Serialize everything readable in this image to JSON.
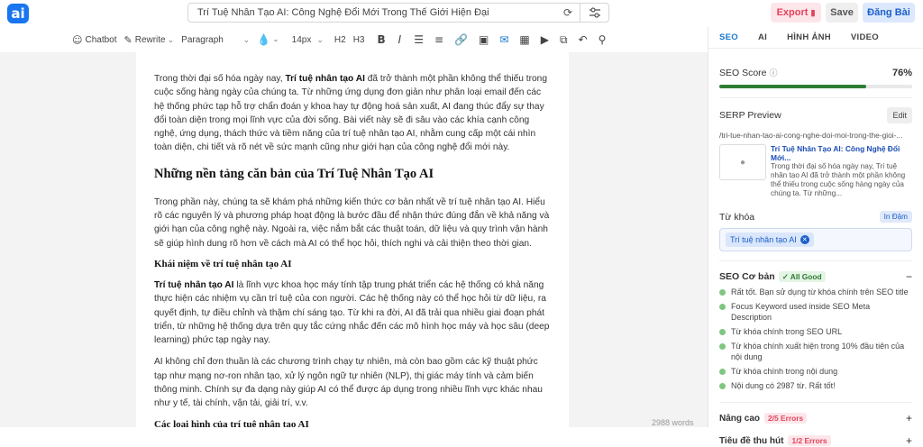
{
  "header": {
    "logo": "ai",
    "doc_title": "Trí Tuệ Nhân Tạo AI: Công Nghệ Đổi Mới Trong Thế Giới Hiện Đại",
    "export_label": "Export",
    "save_label": "Save",
    "publish_label": "Đăng Bài"
  },
  "toolbar": {
    "chatbot_label": "Chatbot",
    "rewrite_label": "Rewrite",
    "paragraph_select": "Paragraph",
    "font_size_select": "14px",
    "h2_label": "H2",
    "h3_label": "H3",
    "bold_label": "B",
    "italic_label": "I"
  },
  "article": {
    "intro_bold": "Trí tuệ nhân tạo AI",
    "intro_pre": "Trong thời đại số hóa ngày nay, ",
    "intro_post": " đã trở thành một phần không thể thiếu trong cuộc sống hàng ngày của chúng ta. Từ những ứng dụng đơn giản như phân loại email đến các hệ thống phức tạp hỗ trợ chẩn đoán y khoa hay tự động hoá sản xuất, AI đang thúc đẩy sự thay đổi toàn diện trong mọi lĩnh vực của đời sống. Bài viết này sẽ đi sâu vào các khía cạnh công nghệ, ứng dụng, thách thức và tiềm năng của trí tuệ nhân tạo AI, nhằm cung cấp một cái nhìn toàn diện, chi tiết và rõ nét về sức mạnh cũng như giới hạn của công nghệ đổi mới này.",
    "h2_1": "Những nền tảng căn bản của Trí Tuệ Nhân Tạo AI",
    "p2": "Trong phần này, chúng ta sẽ khám phá những kiến thức cơ bản nhất về trí tuệ nhân tạo AI. Hiểu rõ các nguyên lý và phương pháp hoạt động là bước đầu để nhận thức đúng đắn về khả năng và giới hạn của công nghệ này. Ngoài ra, việc nắm bắt các thuật toán, dữ liệu và quy trình vận hành sẽ giúp hình dung rõ hơn về cách mà AI có thể học hỏi, thích nghi và cải thiện theo thời gian.",
    "h3_1": "Khái niệm về trí tuệ nhân tạo AI",
    "p3_bold": "Trí tuệ nhân tạo AI",
    "p3_post": " là lĩnh vực khoa học máy tính tập trung phát triển các hệ thống có khả năng thực hiện các nhiệm vụ cần trí tuệ của con người. Các hệ thống này có thể học hỏi từ dữ liệu, ra quyết định, tự điều chỉnh và thậm chí sáng tạo. Từ khi ra đời, AI đã trải qua nhiều giai đoạn phát triển, từ những hệ thống dựa trên quy tắc cứng nhắc đến các mô hình học máy và học sâu (deep learning) phức tạp ngày nay.",
    "p4": "AI không chỉ đơn thuần là các chương trình chạy tự nhiên, mà còn bao gồm các kỹ thuật phức tạp như mạng nơ-ron nhân tạo, xử lý ngôn ngữ tự nhiên (NLP), thị giác máy tính và cảm biến thông minh. Chính sự đa dạng này giúp AI có thể được áp dụng trong nhiều lĩnh vực khác nhau như y tế, tài chính, vận tải, giải trí, v.v.",
    "h3_2": "Các loại hình của trí tuệ nhân tạo AI",
    "word_count": "2988 words"
  },
  "sidebar": {
    "tabs": [
      "SEO",
      "AI",
      "HÌNH ẢNH",
      "VIDEO"
    ],
    "seo_score_label": "SEO Score",
    "seo_score_value": "76%",
    "seo_score_fraction": 0.76,
    "serp_label": "SERP Preview",
    "edit_label": "Edit",
    "serp_url": "/tri-tue-nhan-tao-ai-cong-nghe-doi-moi-trong-the-gioi-...",
    "serp_title": "Trí Tuệ Nhân Tạo AI: Công Nghệ Đổi Mới...",
    "serp_desc": "Trong thời đại số hóa ngày nay, Trí tuệ nhân tạo AI đã trở thành một phần không thể thiếu trong cuộc sống hàng ngày của chúng ta. Từ những...",
    "keyword_label": "Từ khóa",
    "keyword_badge": "In Đậm",
    "keyword_chip": "Trí tuệ nhân tạo AI",
    "basic_label": "SEO Cơ bản",
    "basic_status": "✓ All Good",
    "checks": [
      "Rất tốt. Bạn sử dụng từ khóa chính trên SEO title",
      "Focus Keyword used inside SEO Meta Description",
      "Từ khóa chính trong SEO URL",
      "Từ khóa chính xuất hiện trong 10% đầu tiên của nội dung",
      "Từ khóa chính trong nội dung",
      "Nội dung có 2987 từ. Rất tốt!"
    ],
    "advanced_label": "Nâng cao",
    "advanced_errors": "2/5 Errors",
    "headline_label": "Tiêu đề thu hút",
    "headline_errors": "1/2 Errors",
    "colors": {
      "accent": "#1976d2",
      "good": "#2e7d32",
      "error": "#e2445c"
    }
  }
}
